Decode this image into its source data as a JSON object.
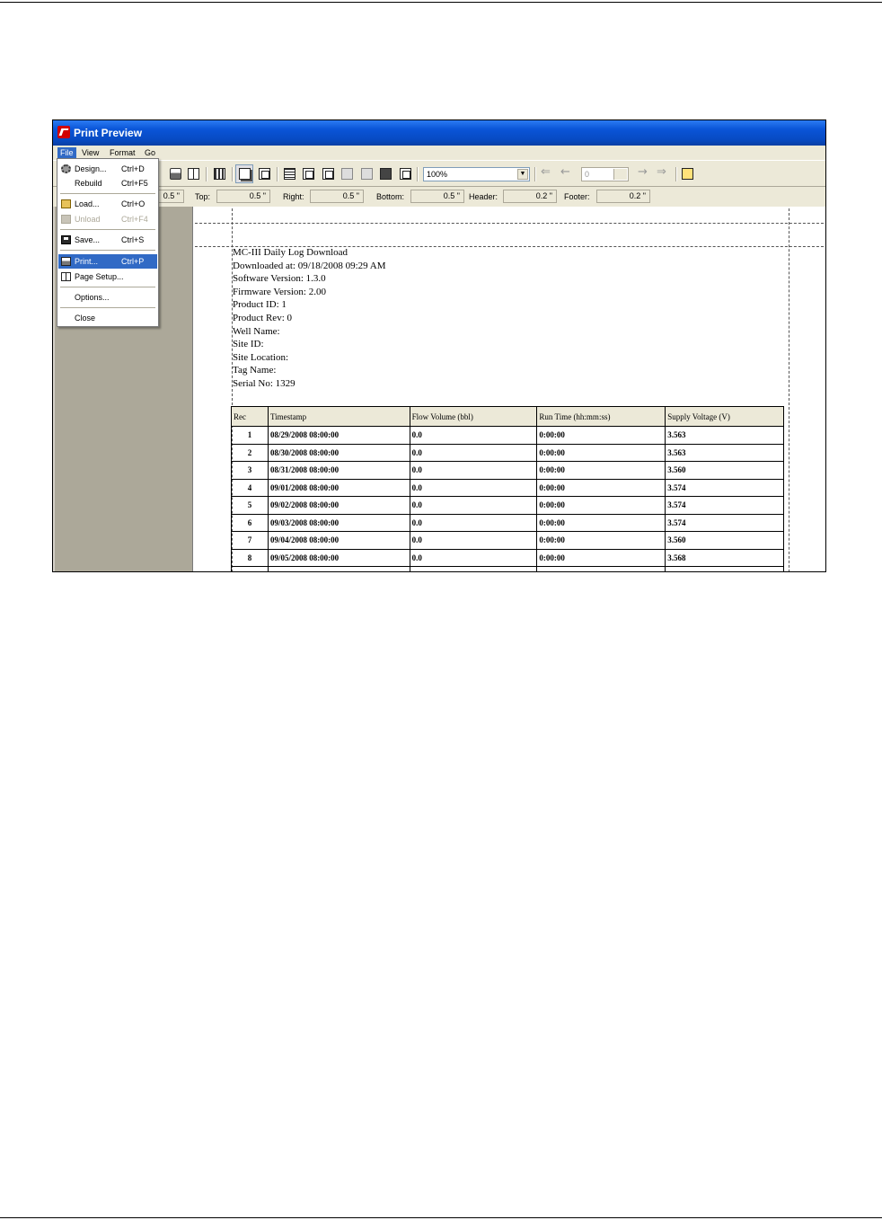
{
  "window": {
    "title": "Print Preview"
  },
  "menubar": {
    "items": [
      "File",
      "View",
      "Format",
      "Go"
    ]
  },
  "toolbar": {
    "zoom": "100%",
    "page": "0"
  },
  "margins": {
    "left_value": "0.5 \"",
    "top_label": "Top:",
    "top_value": "0.5 \"",
    "right_label": "Right:",
    "right_value": "0.5 \"",
    "bottom_label": "Bottom:",
    "bottom_value": "0.5 \"",
    "header_label": "Header:",
    "header_value": "0.2 \"",
    "footer_label": "Footer:",
    "footer_value": "0.2 \""
  },
  "file_menu": {
    "items": [
      {
        "label": "Design...",
        "shortcut": "Ctrl+D",
        "icon": "gear-icon",
        "disabled": false,
        "highlighted": false
      },
      {
        "label": "Rebuild",
        "shortcut": "Ctrl+F5",
        "icon": "",
        "disabled": false,
        "highlighted": false
      },
      {
        "label": "Load...",
        "shortcut": "Ctrl+O",
        "icon": "open-folder-icon",
        "disabled": false,
        "highlighted": false
      },
      {
        "label": "Unload",
        "shortcut": "Ctrl+F4",
        "icon": "unload-folder-icon",
        "disabled": true,
        "highlighted": false
      },
      {
        "label": "Save...",
        "shortcut": "Ctrl+S",
        "icon": "save-disk-icon",
        "disabled": false,
        "highlighted": false
      },
      {
        "label": "Print...",
        "shortcut": "Ctrl+P",
        "icon": "printer-icon",
        "disabled": false,
        "highlighted": true
      },
      {
        "label": "Page Setup...",
        "shortcut": "",
        "icon": "page-setup-icon",
        "disabled": false,
        "highlighted": false
      },
      {
        "label": "Options...",
        "shortcut": "",
        "icon": "",
        "disabled": false,
        "highlighted": false
      },
      {
        "label": "Close",
        "shortcut": "",
        "icon": "",
        "disabled": false,
        "highlighted": false
      }
    ]
  },
  "report": {
    "header_lines": [
      "MC-III Daily Log Download",
      "Downloaded at: 09/18/2008 09:29 AM",
      "Software Version: 1.3.0",
      "Firmware Version: 2.00",
      "Product ID: 1",
      "Product Rev: 0",
      "Well Name:",
      "Site ID:",
      "Site Location:",
      "Tag Name:",
      "Serial No: 1329"
    ],
    "columns": [
      "Rec",
      "Timestamp",
      "Flow Volume (bbl)",
      "Run Time (hh:mm:ss)",
      "Supply Voltage (V)"
    ],
    "rows": [
      [
        "1",
        "08/29/2008 08:00:00",
        "0.0",
        "0:00:00",
        "3.563"
      ],
      [
        "2",
        "08/30/2008 08:00:00",
        "0.0",
        "0:00:00",
        "3.563"
      ],
      [
        "3",
        "08/31/2008 08:00:00",
        "0.0",
        "0:00:00",
        "3.560"
      ],
      [
        "4",
        "09/01/2008 08:00:00",
        "0.0",
        "0:00:00",
        "3.574"
      ],
      [
        "5",
        "09/02/2008 08:00:00",
        "0.0",
        "0:00:00",
        "3.574"
      ],
      [
        "6",
        "09/03/2008 08:00:00",
        "0.0",
        "0:00:00",
        "3.574"
      ],
      [
        "7",
        "09/04/2008 08:00:00",
        "0.0",
        "0:00:00",
        "3.560"
      ],
      [
        "8",
        "09/05/2008 08:00:00",
        "0.0",
        "0:00:00",
        "3.568"
      ]
    ]
  }
}
